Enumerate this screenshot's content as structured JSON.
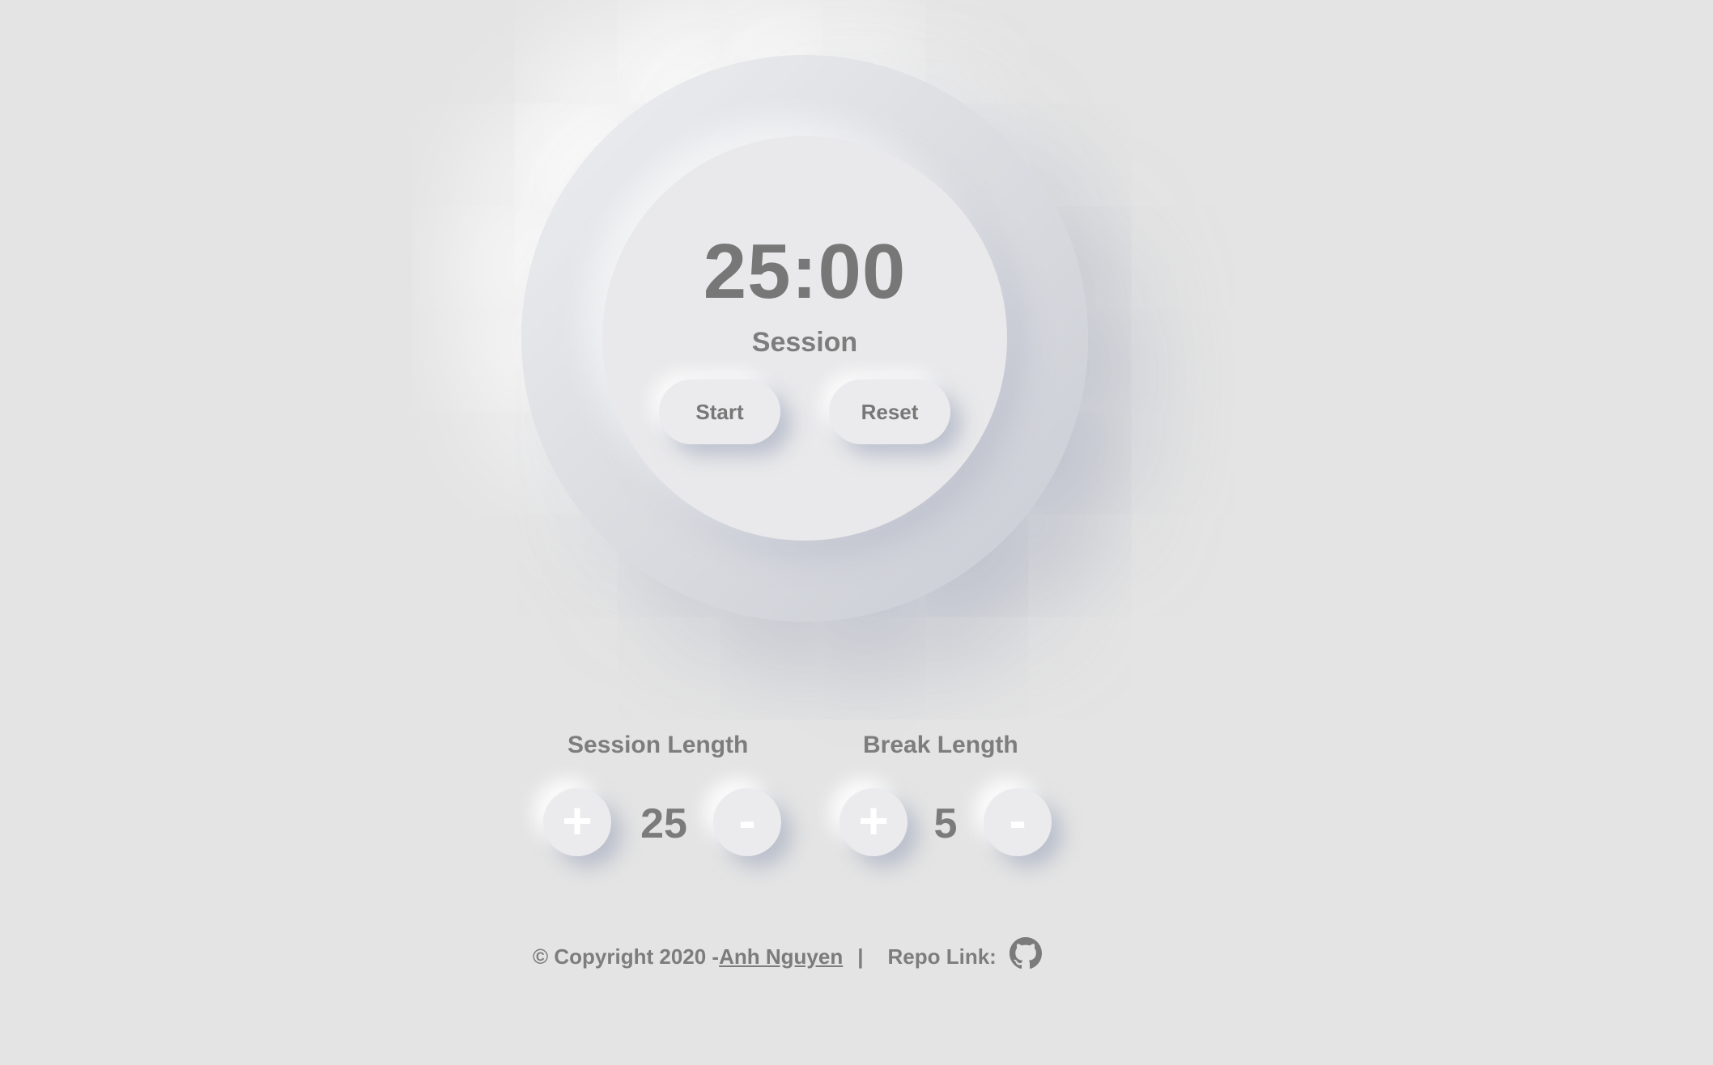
{
  "timer": {
    "time": "25:00",
    "label": "Session",
    "start_label": "Start",
    "reset_label": "Reset"
  },
  "session": {
    "title": "Session Length",
    "increment_label": "+",
    "value": "25",
    "decrement_label": "-"
  },
  "break": {
    "title": "Break Length",
    "increment_label": "+",
    "value": "5",
    "decrement_label": "-"
  },
  "footer": {
    "copyright": "© Copyright 2020 - ",
    "author": "Anh Nguyen",
    "separator": "|",
    "repo_label": "Repo Link:",
    "repo_icon": "github-icon"
  },
  "colors": {
    "background": "#e4e4e4",
    "text": "#7b7b7b",
    "button_glyph": "#ffffff"
  }
}
